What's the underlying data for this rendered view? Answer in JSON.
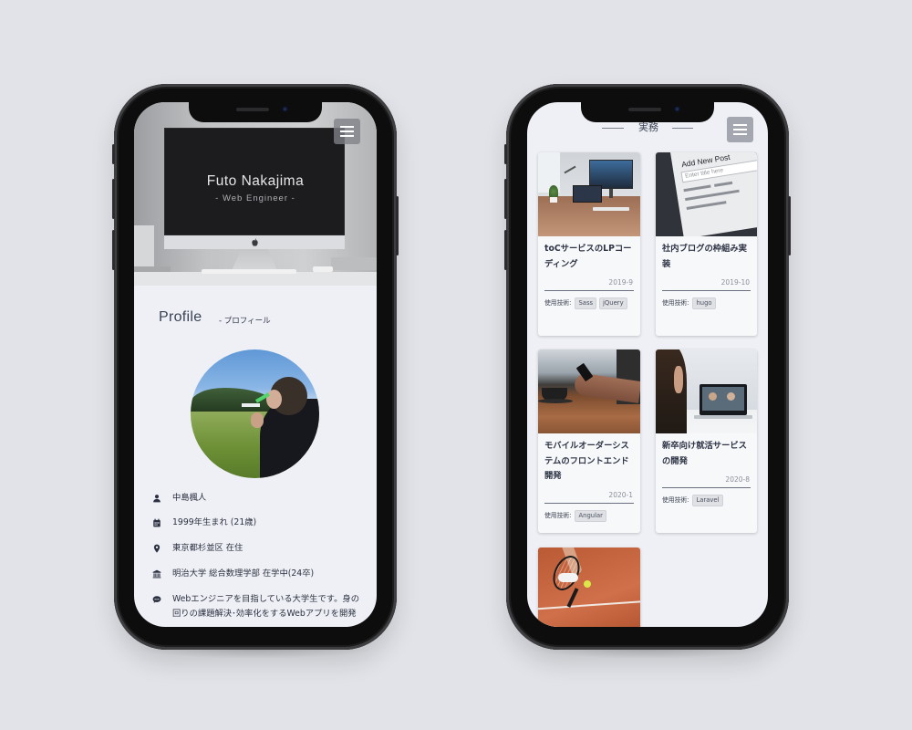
{
  "left_phone": {
    "hero": {
      "name": "Futo Nakajima",
      "role": "- Web Engineer -"
    },
    "profile": {
      "title": "Profile",
      "subtitle": "- プロフィール",
      "name": "中島楓人",
      "birth": "1999年生まれ (21歳)",
      "residence": "東京都杉並区 在住",
      "school": "明治大学 総合数理学部 在学中(24卒)",
      "message_lines": [
        "Webエンジニアを目指している大学生です。身の",
        "回りの課題解決･効率化をするWebアプリを開発"
      ]
    }
  },
  "right_phone": {
    "section_title": "実務",
    "tech_label": "使用技術:",
    "works": [
      {
        "title_lines": [
          "toCサービスのLPコー",
          "ディング"
        ],
        "date": "2019-9",
        "tags": [
          "Sass",
          "jQuery"
        ]
      },
      {
        "title_lines": [
          "社内ブログの枠組み実",
          "装"
        ],
        "date": "2019-10",
        "tags": [
          "hugo"
        ],
        "image_text": [
          "Add New Post",
          "Enter title here"
        ]
      },
      {
        "title_lines": [
          "モバイルオーダーシス",
          "テムのフロントエンド",
          "開発"
        ],
        "date": "2020-1",
        "tags": [
          "Angular"
        ]
      },
      {
        "title_lines": [
          "新卒向け就活サービス",
          "の開発"
        ],
        "date": "2020-8",
        "tags": [
          "Laravel"
        ]
      }
    ]
  },
  "icons": [
    "menu-icon",
    "user-icon",
    "calendar-icon",
    "map-pin-icon",
    "university-icon",
    "chat-icon",
    "apple-logo-icon"
  ],
  "colors": {
    "background": "#e1e3e8",
    "screen_background": "#eef0f5",
    "text": "#2f3546",
    "menu_button": "#808288"
  }
}
